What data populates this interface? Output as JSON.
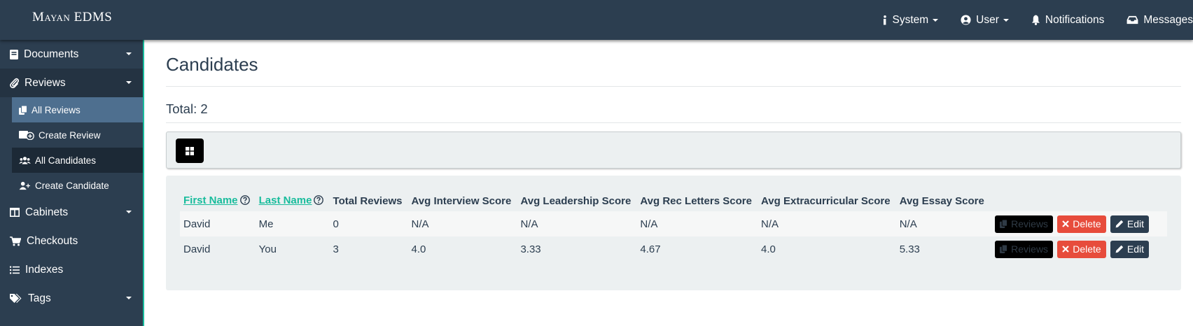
{
  "brand": "Mayan EDMS",
  "topnav": {
    "system": "System",
    "user": "User",
    "notifications": "Notifications",
    "messages": "Messages"
  },
  "sidebar": {
    "documents": "Documents",
    "reviews": "Reviews",
    "reviews_sub": {
      "all_reviews": "All Reviews",
      "create_review": "Create Review",
      "all_candidates": "All Candidates",
      "create_candidate": "Create Candidate"
    },
    "cabinets": "Cabinets",
    "checkouts": "Checkouts",
    "indexes": "Indexes",
    "tags": "Tags"
  },
  "page": {
    "title": "Candidates",
    "total": "Total: 2"
  },
  "table": {
    "headers": {
      "first_name": "First Name",
      "last_name": "Last Name",
      "total_reviews": "Total Reviews",
      "avg_interview": "Avg Interview Score",
      "avg_leadership": "Avg Leadership Score",
      "avg_rec_letters": "Avg Rec Letters Score",
      "avg_extracurricular": "Avg Extracurricular Score",
      "avg_essay": "Avg Essay Score"
    },
    "rows": [
      {
        "first_name": "David",
        "last_name": "Me",
        "total_reviews": "0",
        "avg_interview": "N/A",
        "avg_leadership": "N/A",
        "avg_rec_letters": "N/A",
        "avg_extracurricular": "N/A",
        "avg_essay": "N/A"
      },
      {
        "first_name": "David",
        "last_name": "You",
        "total_reviews": "3",
        "avg_interview": "4.0",
        "avg_leadership": "3.33",
        "avg_rec_letters": "4.67",
        "avg_extracurricular": "4.0",
        "avg_essay": "5.33"
      }
    ],
    "actions": {
      "reviews": "Reviews",
      "delete": "Delete",
      "edit": "Edit"
    }
  },
  "colors": {
    "navbar": "#2c3e50",
    "accent": "#18bc9c",
    "danger": "#e74c3c",
    "panel": "#ecf0f1",
    "selected_item": "#4e6f8f"
  },
  "icons": [
    "info-icon",
    "user-circle-icon",
    "bell-icon",
    "inbox-icon",
    "book-icon",
    "paperclip-icon",
    "copy-icon",
    "folder-plus-icon",
    "users-icon",
    "user-plus-icon",
    "columns-icon",
    "cart-icon",
    "list-icon",
    "tags-icon",
    "grid-icon",
    "question-circle-icon",
    "times-icon",
    "pencil-icon"
  ]
}
